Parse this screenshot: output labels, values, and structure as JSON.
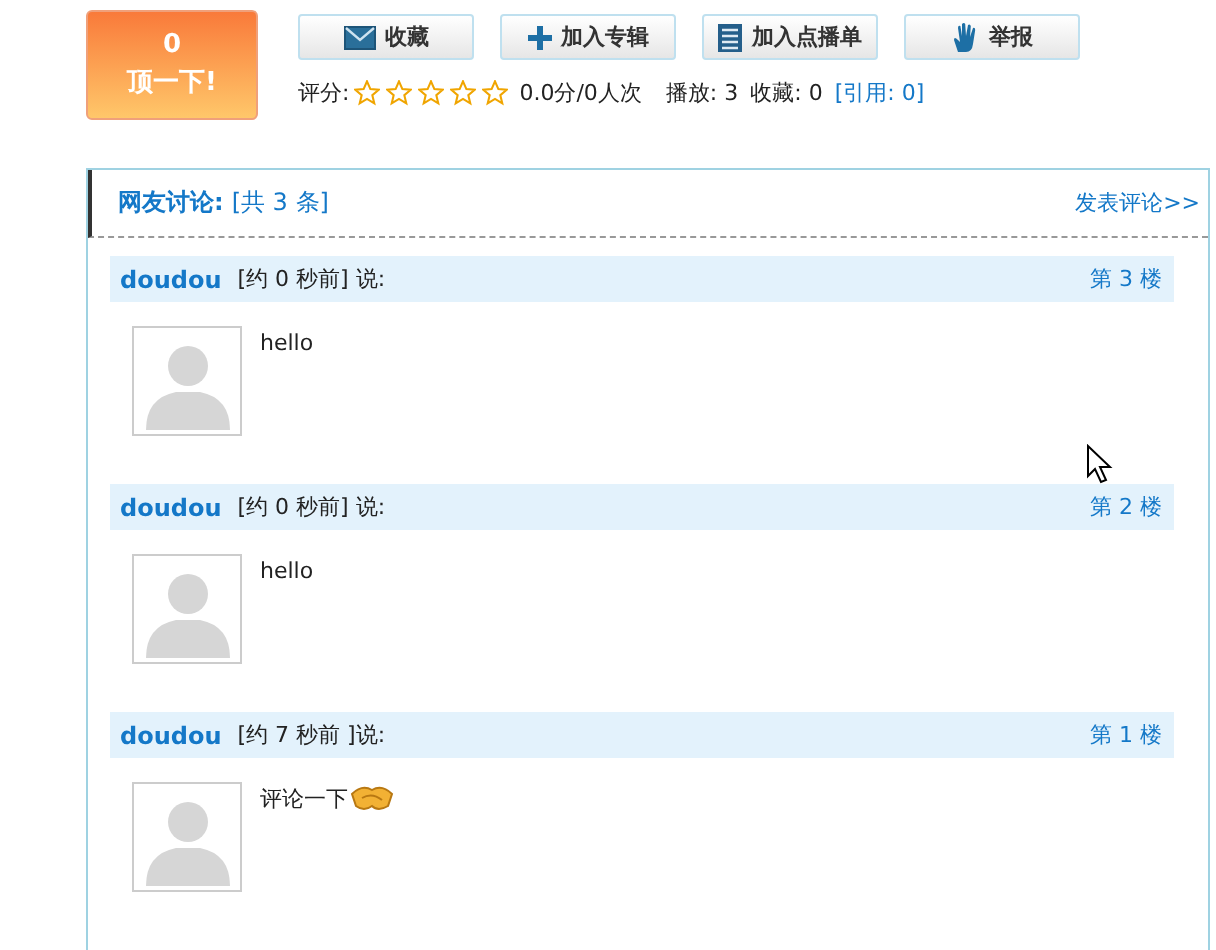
{
  "vote": {
    "count": "0",
    "label": "顶一下!"
  },
  "actions": [
    {
      "label": "收藏",
      "kind": "mail"
    },
    {
      "label": "加入专辑",
      "kind": "plus"
    },
    {
      "label": "加入点播单",
      "kind": "list"
    },
    {
      "label": "举报",
      "kind": "hand"
    }
  ],
  "stats": {
    "rating_label": "评分:",
    "stars": 0,
    "rating_text": "0.0分/0人次",
    "plays": "播放: 3",
    "favorites": "收藏: 0",
    "cite_link": "[引用: 0]"
  },
  "discussion": {
    "title": "网友讨论:",
    "count": "[共 3 条]",
    "post_link": "发表评论>>",
    "comments": [
      {
        "user": "doudou",
        "time": "[约 0 秒前] 说:",
        "floor": "第 3 楼",
        "text": "hello",
        "emoji": false
      },
      {
        "user": "doudou",
        "time": "[约 0 秒前] 说:",
        "floor": "第 2 楼",
        "text": "hello",
        "emoji": false
      },
      {
        "user": "doudou",
        "time": "[约 7 秒前 ]说:",
        "floor": "第 1 楼",
        "text": "评论一下",
        "emoji": true
      }
    ]
  }
}
